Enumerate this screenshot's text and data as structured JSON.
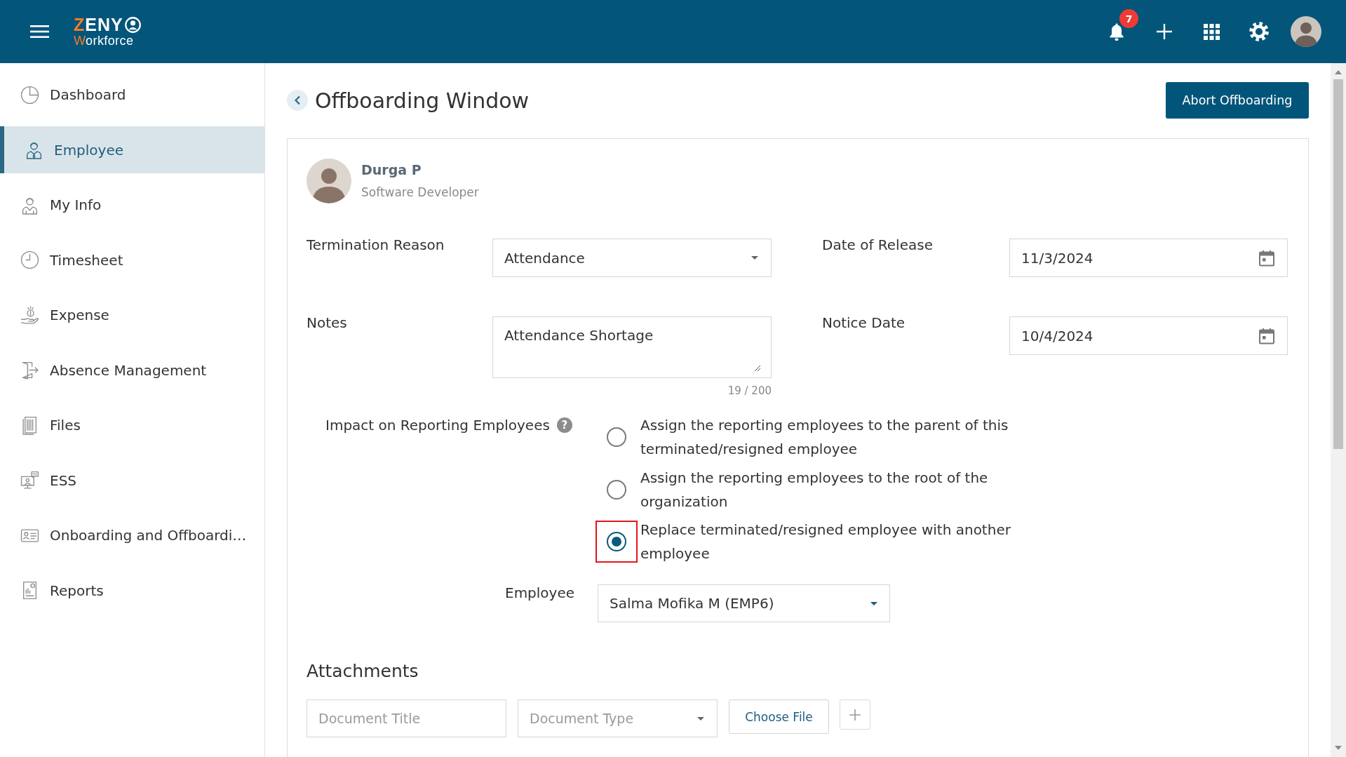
{
  "header": {
    "logo": {
      "line_1": "ZENY",
      "line_2": "Workforce"
    },
    "notification_count": "7"
  },
  "sidebar": {
    "items": [
      {
        "label": "Dashboard",
        "selected": false
      },
      {
        "label": "Employee",
        "selected": true
      },
      {
        "label": "My Info",
        "selected": false
      },
      {
        "label": "Timesheet",
        "selected": false
      },
      {
        "label": "Expense",
        "selected": false
      },
      {
        "label": "Absence Management",
        "selected": false
      },
      {
        "label": "Files",
        "selected": false
      },
      {
        "label": "ESS",
        "selected": false
      },
      {
        "label": "Onboarding and Offboardi…",
        "selected": false
      },
      {
        "label": "Reports",
        "selected": false
      }
    ]
  },
  "page": {
    "title": "Offboarding Window",
    "action_button": "Abort Offboarding"
  },
  "employee": {
    "name": "Durga P",
    "role": "Software Developer"
  },
  "form": {
    "termination_reason": {
      "label": "Termination Reason",
      "value": "Attendance"
    },
    "date_of_release": {
      "label": "Date of Release",
      "value": "11/3/2024"
    },
    "notes": {
      "label": "Notes",
      "value": "Attendance Shortage",
      "counter": "19 / 200"
    },
    "notice_date": {
      "label": "Notice Date",
      "value": "10/4/2024"
    },
    "impact": {
      "label": "Impact on Reporting Employees",
      "help": "?",
      "options": [
        {
          "label": "Assign the reporting employees to the parent of this terminated/resigned employee",
          "selected": false,
          "highlighted": false
        },
        {
          "label": "Assign the reporting employees to the root of the organization",
          "selected": false,
          "highlighted": false
        },
        {
          "label": "Replace terminated/resigned employee with another employee",
          "selected": true,
          "highlighted": true
        }
      ]
    },
    "replacement_employee": {
      "label": "Employee",
      "value": "Salma Mofika M (EMP6)"
    }
  },
  "attachments": {
    "title": "Attachments",
    "document_title": {
      "placeholder": "Document Title"
    },
    "document_type": {
      "placeholder": "Document Type"
    },
    "choose_file_button": "Choose File"
  }
}
